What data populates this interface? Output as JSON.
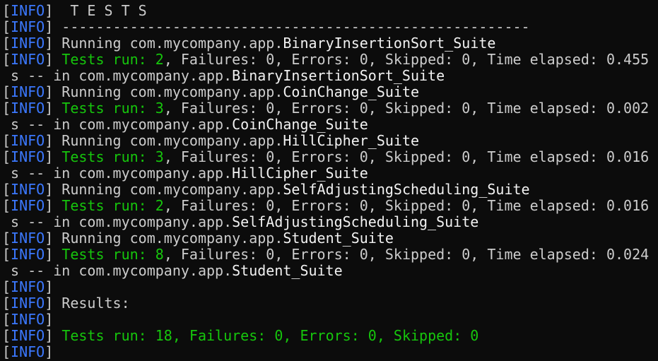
{
  "terminal": {
    "colors": {
      "background": "#0c0c0c",
      "text": "#cccccc",
      "level": "#3b78ff",
      "success": "#16c60c",
      "bright": "#f2f2f2"
    },
    "lines": [
      {
        "type": "log",
        "segments": [
          {
            "text": "  T E S T S",
            "style": "normal"
          }
        ]
      },
      {
        "type": "log",
        "segments": [
          {
            "text": " -------------------------------------------------------",
            "style": "normal"
          }
        ]
      },
      {
        "type": "log",
        "segments": [
          {
            "text": " Running com.mycompany.app.",
            "style": "normal"
          },
          {
            "text": "BinaryInsertionSort_Suite",
            "style": "bold"
          }
        ]
      },
      {
        "type": "log",
        "segments": [
          {
            "text": " ",
            "style": "normal"
          },
          {
            "text": "Tests run: 2",
            "style": "green"
          },
          {
            "text": ", Failures: 0, Errors: 0, Skipped: 0, Time elapsed: 0.455",
            "style": "normal"
          }
        ]
      },
      {
        "type": "cont",
        "segments": [
          {
            "text": " s -- in com.mycompany.app.",
            "style": "normal"
          },
          {
            "text": "BinaryInsertionSort_Suite",
            "style": "bold"
          }
        ]
      },
      {
        "type": "log",
        "segments": [
          {
            "text": " Running com.mycompany.app.",
            "style": "normal"
          },
          {
            "text": "CoinChange_Suite",
            "style": "bold"
          }
        ]
      },
      {
        "type": "log",
        "segments": [
          {
            "text": " ",
            "style": "normal"
          },
          {
            "text": "Tests run: 3",
            "style": "green"
          },
          {
            "text": ", Failures: 0, Errors: 0, Skipped: 0, Time elapsed: 0.002",
            "style": "normal"
          }
        ]
      },
      {
        "type": "cont",
        "segments": [
          {
            "text": " s -- in com.mycompany.app.",
            "style": "normal"
          },
          {
            "text": "CoinChange_Suite",
            "style": "bold"
          }
        ]
      },
      {
        "type": "log",
        "segments": [
          {
            "text": " Running com.mycompany.app.",
            "style": "normal"
          },
          {
            "text": "HillCipher_Suite",
            "style": "bold"
          }
        ]
      },
      {
        "type": "log",
        "segments": [
          {
            "text": " ",
            "style": "normal"
          },
          {
            "text": "Tests run: 3",
            "style": "green"
          },
          {
            "text": ", Failures: 0, Errors: 0, Skipped: 0, Time elapsed: 0.016",
            "style": "normal"
          }
        ]
      },
      {
        "type": "cont",
        "segments": [
          {
            "text": " s -- in com.mycompany.app.",
            "style": "normal"
          },
          {
            "text": "HillCipher_Suite",
            "style": "bold"
          }
        ]
      },
      {
        "type": "log",
        "segments": [
          {
            "text": " Running com.mycompany.app.",
            "style": "normal"
          },
          {
            "text": "SelfAdjustingScheduling_Suite",
            "style": "bold"
          }
        ]
      },
      {
        "type": "log",
        "segments": [
          {
            "text": " ",
            "style": "normal"
          },
          {
            "text": "Tests run: 2",
            "style": "green"
          },
          {
            "text": ", Failures: 0, Errors: 0, Skipped: 0, Time elapsed: 0.016",
            "style": "normal"
          }
        ]
      },
      {
        "type": "cont",
        "segments": [
          {
            "text": " s -- in com.mycompany.app.",
            "style": "normal"
          },
          {
            "text": "SelfAdjustingScheduling_Suite",
            "style": "bold"
          }
        ]
      },
      {
        "type": "log",
        "segments": [
          {
            "text": " Running com.mycompany.app.",
            "style": "normal"
          },
          {
            "text": "Student_Suite",
            "style": "bold"
          }
        ]
      },
      {
        "type": "log",
        "segments": [
          {
            "text": " ",
            "style": "normal"
          },
          {
            "text": "Tests run: 8",
            "style": "green"
          },
          {
            "text": ", Failures: 0, Errors: 0, Skipped: 0, Time elapsed: 0.024",
            "style": "normal"
          }
        ]
      },
      {
        "type": "cont",
        "segments": [
          {
            "text": " s -- in com.mycompany.app.",
            "style": "normal"
          },
          {
            "text": "Student_Suite",
            "style": "bold"
          }
        ]
      },
      {
        "type": "log",
        "segments": []
      },
      {
        "type": "log",
        "segments": [
          {
            "text": " Results:",
            "style": "normal"
          }
        ]
      },
      {
        "type": "log",
        "segments": []
      },
      {
        "type": "log",
        "segments": [
          {
            "text": " ",
            "style": "normal"
          },
          {
            "text": "Tests run: 18, Failures: 0, Errors: 0, Skipped: 0",
            "style": "green"
          }
        ]
      },
      {
        "type": "log",
        "segments": []
      }
    ],
    "prefix": {
      "open": "[",
      "level": "INFO",
      "close": "]"
    }
  }
}
